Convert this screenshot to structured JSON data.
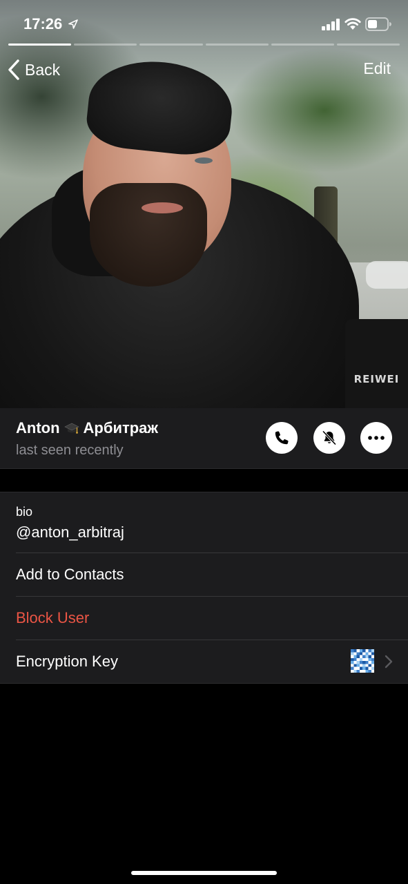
{
  "status_bar": {
    "time": "17:26",
    "icons": [
      "location-arrow-icon",
      "signal-icon",
      "wifi-icon",
      "battery-icon"
    ]
  },
  "photo": {
    "cup_text": "REIWEI",
    "segments_total": 6,
    "segments_active": 1
  },
  "nav": {
    "back_label": "Back",
    "edit_label": "Edit"
  },
  "profile": {
    "name_first": "Anton",
    "name_last": "Арбитраж",
    "name_emoji_icon": "graduation-cap-icon",
    "last_seen": "last seen recently",
    "actions": [
      "phone-icon",
      "bell-muted-icon",
      "more-icon"
    ]
  },
  "bio": {
    "label": "bio",
    "value": "@anton_arbitraj"
  },
  "rows": {
    "add_contacts": "Add to Contacts",
    "block_user": "Block User",
    "encryption_key": "Encryption Key"
  },
  "colors": {
    "background": "#000000",
    "cell": "#1c1c1e",
    "danger": "#eb5545",
    "secondary_text": "#8e8e93"
  }
}
